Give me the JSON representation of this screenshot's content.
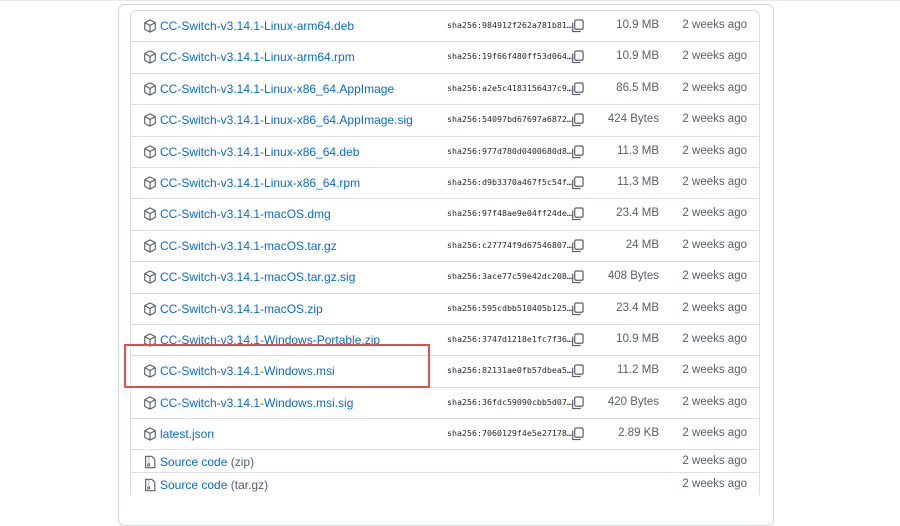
{
  "assets": [
    {
      "name": "CC-Switch-v3.14.1-Linux-arm64.deb",
      "sha": "sha256:984912f262a781b81…",
      "size": "10.9 MB",
      "age": "2 weeks ago"
    },
    {
      "name": "CC-Switch-v3.14.1-Linux-arm64.rpm",
      "sha": "sha256:19f66f480ff53d064…",
      "size": "10.9 MB",
      "age": "2 weeks ago"
    },
    {
      "name": "CC-Switch-v3.14.1-Linux-x86_64.AppImage",
      "sha": "sha256:a2e5c4183156437c9…",
      "size": "86.5 MB",
      "age": "2 weeks ago"
    },
    {
      "name": "CC-Switch-v3.14.1-Linux-x86_64.AppImage.sig",
      "sha": "sha256:54097bd67697a6872…",
      "size": "424 Bytes",
      "age": "2 weeks ago"
    },
    {
      "name": "CC-Switch-v3.14.1-Linux-x86_64.deb",
      "sha": "sha256:977d780d0400680d8…",
      "size": "11.3 MB",
      "age": "2 weeks ago"
    },
    {
      "name": "CC-Switch-v3.14.1-Linux-x86_64.rpm",
      "sha": "sha256:d9b3370a467f5c54f…",
      "size": "11.3 MB",
      "age": "2 weeks ago"
    },
    {
      "name": "CC-Switch-v3.14.1-macOS.dmg",
      "sha": "sha256:97f48ae9e04ff24de…",
      "size": "23.4 MB",
      "age": "2 weeks ago"
    },
    {
      "name": "CC-Switch-v3.14.1-macOS.tar.gz",
      "sha": "sha256:c27774f9d67546807…",
      "size": "24 MB",
      "age": "2 weeks ago"
    },
    {
      "name": "CC-Switch-v3.14.1-macOS.tar.gz.sig",
      "sha": "sha256:3ace77c59e42dc208…",
      "size": "408 Bytes",
      "age": "2 weeks ago"
    },
    {
      "name": "CC-Switch-v3.14.1-macOS.zip",
      "sha": "sha256:595cdbb510405b125…",
      "size": "23.4 MB",
      "age": "2 weeks ago"
    },
    {
      "name": "CC-Switch-v3.14.1-Windows-Portable.zip",
      "sha": "sha256:3747d1218e1fc7f36…",
      "size": "10.9 MB",
      "age": "2 weeks ago"
    },
    {
      "name": "CC-Switch-v3.14.1-Windows.msi",
      "sha": "sha256:82131ae0fb57dbea5…",
      "size": "11.2 MB",
      "age": "2 weeks ago"
    },
    {
      "name": "CC-Switch-v3.14.1-Windows.msi.sig",
      "sha": "sha256:36fdc59090cbb5d07…",
      "size": "420 Bytes",
      "age": "2 weeks ago"
    },
    {
      "name": "latest.json",
      "sha": "sha256:7060129f4e5e27178…",
      "size": "2.89 KB",
      "age": "2 weeks ago"
    }
  ],
  "source_code": [
    {
      "label": "Source code",
      "suffix": "(zip)",
      "age": "2 weeks ago"
    },
    {
      "label": "Source code",
      "suffix": "(tar.gz)",
      "age": "2 weeks ago"
    }
  ],
  "icons": {
    "asset": "package-icon",
    "source": "file-zip-icon",
    "copy": "copy-icon"
  },
  "colors": {
    "link": "#0969da",
    "highlight": "#e0504a",
    "muted": "#57606a"
  }
}
